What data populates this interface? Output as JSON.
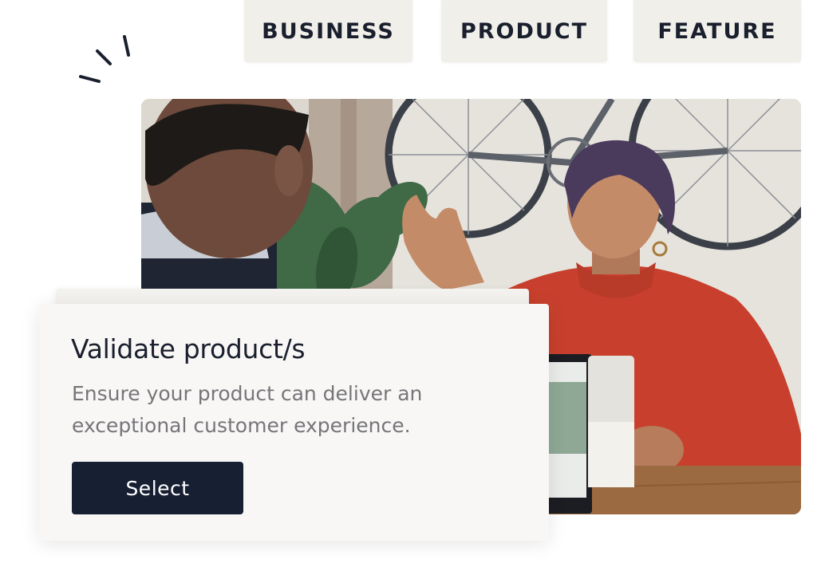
{
  "tabs": [
    {
      "label": "BUSINESS"
    },
    {
      "label": "PRODUCT"
    },
    {
      "label": "FEATURE"
    }
  ],
  "card": {
    "title": "Validate product/s",
    "description": "Ensure your product can deliver an exceptional customer experience.",
    "select_label": "Select"
  },
  "photo": {
    "subject": "photo-icon"
  },
  "colors": {
    "tab_bg": "#f0efe9",
    "text_dark": "#1a1f2e",
    "text_muted": "#76767a",
    "button_bg": "#172033",
    "card_bg": "#f8f7f5"
  }
}
